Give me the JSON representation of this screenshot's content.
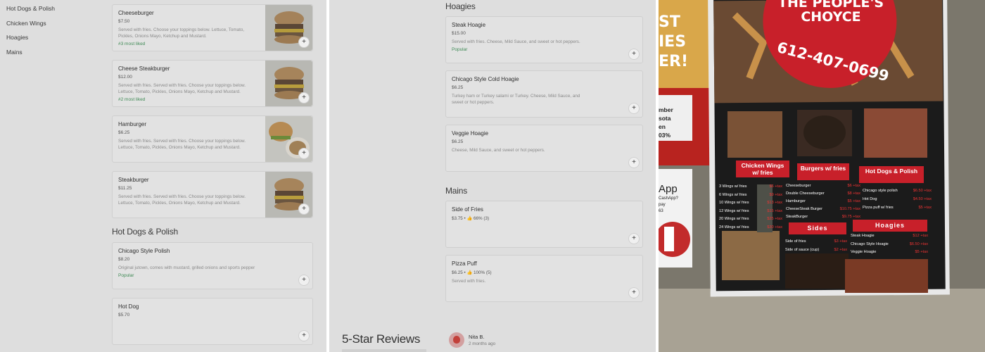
{
  "panel1": {
    "nav": [
      "Hot Dogs & Polish",
      "Chicken Wings",
      "Hoagies",
      "Mains"
    ],
    "burgers": [
      {
        "name": "Cheeseburger",
        "price": "$7.50",
        "desc": "Served with fries. Choose your toppings below. Lettuce, Tomato, Pickles, Onions Mayo, Ketchup and Mustard.",
        "badge": "#3 most liked"
      },
      {
        "name": "Cheese Steakburger",
        "price": "$12.00",
        "desc": "Served with fries. Served with fries. Choose your toppings below. Lettuce, Tomato, Pickles, Onions Mayo, Ketchup and Mustard.",
        "badge": "#2 most liked"
      },
      {
        "name": "Hamburger",
        "price": "$6.25",
        "desc": "Served with fries. Served with fries. Choose your toppings below. Lettuce, Tomato, Pickles, Onions Mayo, Ketchup and Mustard.",
        "badge": ""
      },
      {
        "name": "Steakburger",
        "price": "$11.25",
        "desc": "Served with fries. Served with fries. Choose your toppings below. Lettuce, Tomato, Pickles, Onions Mayo, Ketchup and Mustard.",
        "badge": ""
      }
    ],
    "hotdogs_title": "Hot Dogs & Polish",
    "hotdogs": [
      {
        "name": "Chicago Style Polish",
        "price": "$8.20",
        "desc": "Original jutown, comes with mustard, grilled onions and sports pepper",
        "badge": "Popular"
      },
      {
        "name": "Hot Dog",
        "price": "$5.70",
        "desc": "",
        "badge": ""
      }
    ],
    "add_symbol": "+"
  },
  "panel2": {
    "hoagies_title": "Hoagies",
    "hoagies": [
      {
        "name": "Steak Hoagie",
        "price": "$15.00",
        "desc": "Served with fries. Cheese, Mild Sauce, and sweet or hot peppers.",
        "badge": "Popular"
      },
      {
        "name": "Chicago Style Cold Hoagie",
        "price": "$6.25",
        "desc": "Turkey ham or Turkey salami or Turkey. Cheese, Mild Sauce, and sweet or hot peppers.",
        "badge": ""
      },
      {
        "name": "Veggie Hoagie",
        "price": "$6.25",
        "desc": "Cheese, Mild Sauce, and sweet or hot peppers.",
        "badge": ""
      }
    ],
    "mains_title": "Mains",
    "mains": [
      {
        "name": "Side of Fries",
        "rating": "$3.75 • 👍 66% (3)",
        "desc": ""
      },
      {
        "name": "Pizza Puff",
        "rating": "$6.25 • 👍 100% (5)",
        "desc": "Served with fries."
      }
    ],
    "reviews_title": "5-Star Reviews",
    "reviewer": {
      "name": "Nita B.",
      "time": "2 months ago"
    },
    "add_symbol": "+"
  },
  "poster": {
    "brand": "THE PEOPLE'S CHOYCE",
    "phone": "612-407-0699",
    "wings_title": "Chicken Wings w/ fries",
    "wings": [
      {
        "item": "3 Wings w/ fries",
        "price": "$6 +tax"
      },
      {
        "item": "6 Wings w/ fries",
        "price": "$9 +tax"
      },
      {
        "item": "10 Wings w/ fries",
        "price": "$13 +tax"
      },
      {
        "item": "12 Wings w/ fries",
        "price": "$15 +tax"
      },
      {
        "item": "20 Wings w/ fries",
        "price": "$25 +tax"
      },
      {
        "item": "24 Wings w/ fries",
        "price": "$30 +tax"
      }
    ],
    "burgers_title": "Burgers w/ fries",
    "burgers": [
      {
        "item": "Cheeseburger",
        "price": "$6 +tax"
      },
      {
        "item": "Double Cheeseburger",
        "price": "$8 +tax"
      },
      {
        "item": "Hamburger",
        "price": "$5 +tax"
      },
      {
        "item": "CheeseSteak Burger",
        "price": "$10.75 +tax"
      },
      {
        "item": "SteakBurger",
        "price": "$9.75 +tax"
      }
    ],
    "hotdogs_title": "Hot Dogs & Polish",
    "hotdogs": [
      {
        "item": "Chicago style polish",
        "price": "$6.50 +tax"
      },
      {
        "item": "Hot Dog",
        "price": "$4.50 +tax"
      },
      {
        "item": "Pizza puff w/ fries",
        "price": "$5 +tax"
      }
    ],
    "sides_title": "Sides",
    "sides": [
      {
        "item": "Side of fries",
        "price": "$3 +tax"
      },
      {
        "item": "Side of sauce (cup)",
        "price": "$2 +tax"
      }
    ],
    "hoagies_title": "Hoagies",
    "hoagies": [
      {
        "item": "Steak Hoagie",
        "price": "$12 +tax"
      },
      {
        "item": "Chicago Style Hoagie",
        "price": "$6.50 +tax"
      },
      {
        "item": "Veggie Hoagie",
        "price": "$5 +tax"
      }
    ],
    "wall_sign_left": "ST IES ER!",
    "wall_sign_text": [
      "mber",
      "sota",
      "en",
      "03%"
    ],
    "app_sign": [
      "App",
      "CashApp?",
      "pay",
      "63"
    ]
  },
  "colors": {
    "page_bg": "#dedede",
    "card_bg": "#e2e2e2",
    "badge_green": "#3f8a55",
    "poster_bg": "#1a1a1a",
    "poster_red": "#c8202a"
  }
}
